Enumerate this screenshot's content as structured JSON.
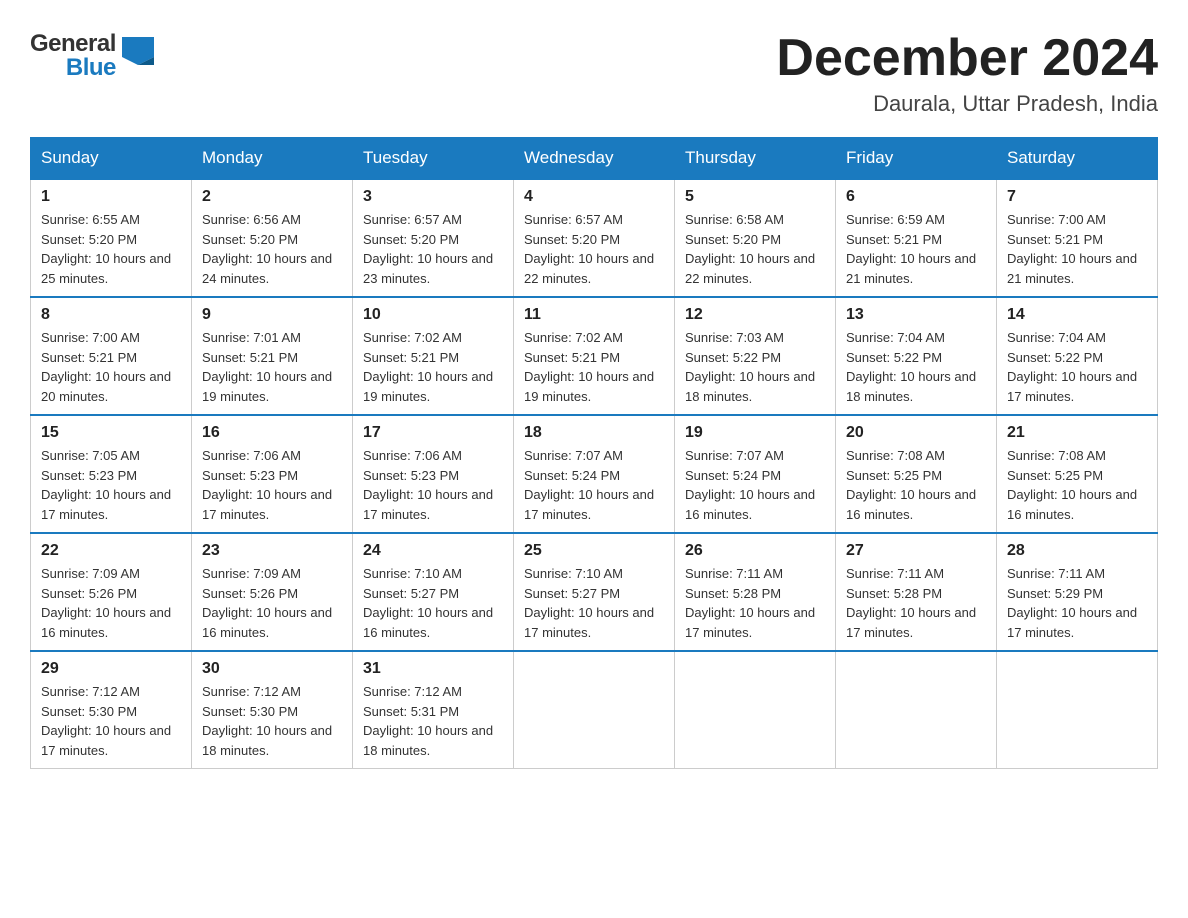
{
  "logo": {
    "text_general": "General",
    "text_blue": "Blue",
    "icon_alt": "GeneralBlue logo"
  },
  "title": "December 2024",
  "subtitle": "Daurala, Uttar Pradesh, India",
  "headers": [
    "Sunday",
    "Monday",
    "Tuesday",
    "Wednesday",
    "Thursday",
    "Friday",
    "Saturday"
  ],
  "weeks": [
    [
      {
        "day": "1",
        "sunrise": "Sunrise: 6:55 AM",
        "sunset": "Sunset: 5:20 PM",
        "daylight": "Daylight: 10 hours and 25 minutes."
      },
      {
        "day": "2",
        "sunrise": "Sunrise: 6:56 AM",
        "sunset": "Sunset: 5:20 PM",
        "daylight": "Daylight: 10 hours and 24 minutes."
      },
      {
        "day": "3",
        "sunrise": "Sunrise: 6:57 AM",
        "sunset": "Sunset: 5:20 PM",
        "daylight": "Daylight: 10 hours and 23 minutes."
      },
      {
        "day": "4",
        "sunrise": "Sunrise: 6:57 AM",
        "sunset": "Sunset: 5:20 PM",
        "daylight": "Daylight: 10 hours and 22 minutes."
      },
      {
        "day": "5",
        "sunrise": "Sunrise: 6:58 AM",
        "sunset": "Sunset: 5:20 PM",
        "daylight": "Daylight: 10 hours and 22 minutes."
      },
      {
        "day": "6",
        "sunrise": "Sunrise: 6:59 AM",
        "sunset": "Sunset: 5:21 PM",
        "daylight": "Daylight: 10 hours and 21 minutes."
      },
      {
        "day": "7",
        "sunrise": "Sunrise: 7:00 AM",
        "sunset": "Sunset: 5:21 PM",
        "daylight": "Daylight: 10 hours and 21 minutes."
      }
    ],
    [
      {
        "day": "8",
        "sunrise": "Sunrise: 7:00 AM",
        "sunset": "Sunset: 5:21 PM",
        "daylight": "Daylight: 10 hours and 20 minutes."
      },
      {
        "day": "9",
        "sunrise": "Sunrise: 7:01 AM",
        "sunset": "Sunset: 5:21 PM",
        "daylight": "Daylight: 10 hours and 19 minutes."
      },
      {
        "day": "10",
        "sunrise": "Sunrise: 7:02 AM",
        "sunset": "Sunset: 5:21 PM",
        "daylight": "Daylight: 10 hours and 19 minutes."
      },
      {
        "day": "11",
        "sunrise": "Sunrise: 7:02 AM",
        "sunset": "Sunset: 5:21 PM",
        "daylight": "Daylight: 10 hours and 19 minutes."
      },
      {
        "day": "12",
        "sunrise": "Sunrise: 7:03 AM",
        "sunset": "Sunset: 5:22 PM",
        "daylight": "Daylight: 10 hours and 18 minutes."
      },
      {
        "day": "13",
        "sunrise": "Sunrise: 7:04 AM",
        "sunset": "Sunset: 5:22 PM",
        "daylight": "Daylight: 10 hours and 18 minutes."
      },
      {
        "day": "14",
        "sunrise": "Sunrise: 7:04 AM",
        "sunset": "Sunset: 5:22 PM",
        "daylight": "Daylight: 10 hours and 17 minutes."
      }
    ],
    [
      {
        "day": "15",
        "sunrise": "Sunrise: 7:05 AM",
        "sunset": "Sunset: 5:23 PM",
        "daylight": "Daylight: 10 hours and 17 minutes."
      },
      {
        "day": "16",
        "sunrise": "Sunrise: 7:06 AM",
        "sunset": "Sunset: 5:23 PM",
        "daylight": "Daylight: 10 hours and 17 minutes."
      },
      {
        "day": "17",
        "sunrise": "Sunrise: 7:06 AM",
        "sunset": "Sunset: 5:23 PM",
        "daylight": "Daylight: 10 hours and 17 minutes."
      },
      {
        "day": "18",
        "sunrise": "Sunrise: 7:07 AM",
        "sunset": "Sunset: 5:24 PM",
        "daylight": "Daylight: 10 hours and 17 minutes."
      },
      {
        "day": "19",
        "sunrise": "Sunrise: 7:07 AM",
        "sunset": "Sunset: 5:24 PM",
        "daylight": "Daylight: 10 hours and 16 minutes."
      },
      {
        "day": "20",
        "sunrise": "Sunrise: 7:08 AM",
        "sunset": "Sunset: 5:25 PM",
        "daylight": "Daylight: 10 hours and 16 minutes."
      },
      {
        "day": "21",
        "sunrise": "Sunrise: 7:08 AM",
        "sunset": "Sunset: 5:25 PM",
        "daylight": "Daylight: 10 hours and 16 minutes."
      }
    ],
    [
      {
        "day": "22",
        "sunrise": "Sunrise: 7:09 AM",
        "sunset": "Sunset: 5:26 PM",
        "daylight": "Daylight: 10 hours and 16 minutes."
      },
      {
        "day": "23",
        "sunrise": "Sunrise: 7:09 AM",
        "sunset": "Sunset: 5:26 PM",
        "daylight": "Daylight: 10 hours and 16 minutes."
      },
      {
        "day": "24",
        "sunrise": "Sunrise: 7:10 AM",
        "sunset": "Sunset: 5:27 PM",
        "daylight": "Daylight: 10 hours and 16 minutes."
      },
      {
        "day": "25",
        "sunrise": "Sunrise: 7:10 AM",
        "sunset": "Sunset: 5:27 PM",
        "daylight": "Daylight: 10 hours and 17 minutes."
      },
      {
        "day": "26",
        "sunrise": "Sunrise: 7:11 AM",
        "sunset": "Sunset: 5:28 PM",
        "daylight": "Daylight: 10 hours and 17 minutes."
      },
      {
        "day": "27",
        "sunrise": "Sunrise: 7:11 AM",
        "sunset": "Sunset: 5:28 PM",
        "daylight": "Daylight: 10 hours and 17 minutes."
      },
      {
        "day": "28",
        "sunrise": "Sunrise: 7:11 AM",
        "sunset": "Sunset: 5:29 PM",
        "daylight": "Daylight: 10 hours and 17 minutes."
      }
    ],
    [
      {
        "day": "29",
        "sunrise": "Sunrise: 7:12 AM",
        "sunset": "Sunset: 5:30 PM",
        "daylight": "Daylight: 10 hours and 17 minutes."
      },
      {
        "day": "30",
        "sunrise": "Sunrise: 7:12 AM",
        "sunset": "Sunset: 5:30 PM",
        "daylight": "Daylight: 10 hours and 18 minutes."
      },
      {
        "day": "31",
        "sunrise": "Sunrise: 7:12 AM",
        "sunset": "Sunset: 5:31 PM",
        "daylight": "Daylight: 10 hours and 18 minutes."
      },
      null,
      null,
      null,
      null
    ]
  ]
}
